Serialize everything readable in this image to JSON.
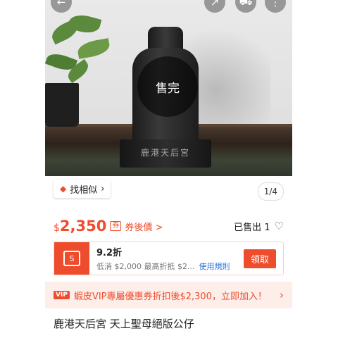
{
  "image": {
    "soldout_label": "售完",
    "statue_base_text": "鹿港天后宮",
    "icons": [
      "back-arrow-icon",
      "share-icon",
      "cart-icon",
      "more-icon"
    ]
  },
  "find_similar": {
    "label": "找相似",
    "chevron": "›"
  },
  "pager": {
    "text": "1/4"
  },
  "price": {
    "currency": "$",
    "amount": "2,350",
    "coupon_link": "券後價 >"
  },
  "sold": {
    "text": "已售出 1"
  },
  "voucher": {
    "discount": "9.2折",
    "description": "低消 $2,000 最高折抵 $2...",
    "rules_link": "使用規則",
    "claim_button": "領取"
  },
  "vip_banner": {
    "badge": "VIP",
    "text": "蝦皮VIP專屬優惠券折扣後$2,300，立即加入！",
    "arrow": "›"
  },
  "product_title": "鹿港天后宮 天上聖母絕版公仔",
  "colors": {
    "accent": "#ee4d2d",
    "link": "#2673dd",
    "vip_bg": "#fdeee9"
  }
}
